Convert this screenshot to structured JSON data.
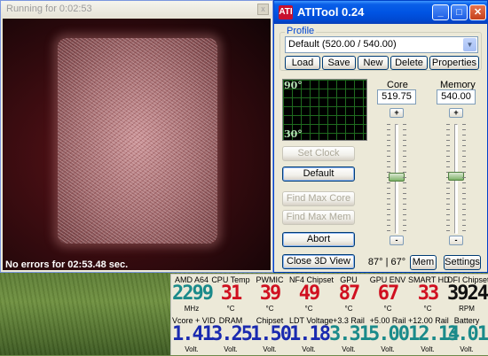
{
  "render_window": {
    "title": "Running for 0:02:53",
    "close": "x",
    "status": "No errors for 02:53.48 sec."
  },
  "ati": {
    "title": "ATITool 0.24",
    "logo": "ATI",
    "buttons": {
      "minimize": "_",
      "maximize": "□",
      "close": "✕"
    },
    "profile_label": "Profile",
    "profile_value": "Default (520.00 / 540.00)",
    "profile_buttons": {
      "load": "Load",
      "save": "Save",
      "new": "New",
      "delete": "Delete",
      "properties": "Properties"
    },
    "graph": {
      "top_label": "90°",
      "bottom_label": "30°"
    },
    "core": {
      "label": "Core",
      "value": "519.75",
      "plus": "+",
      "minus": "-"
    },
    "memory": {
      "label": "Memory",
      "value": "540.00",
      "plus": "+",
      "minus": "-"
    },
    "actions": {
      "set_clock": "Set Clock",
      "default": "Default",
      "find_max_core": "Find Max Core",
      "find_max_mem": "Find Max Mem",
      "abort": "Abort",
      "close_3d": "Close 3D View",
      "temp": "87° | 67°",
      "mem": "Mem",
      "settings": "Settings"
    }
  },
  "sensors": {
    "row1": [
      {
        "label": "AMD A64",
        "value": "2299",
        "unit": "MHz",
        "color": "#1a8a8a"
      },
      {
        "label": "CPU Temp",
        "value": "31",
        "unit": "°C",
        "color": "#d01020"
      },
      {
        "label": "PWMIC",
        "value": "39",
        "unit": "°C",
        "color": "#d01020"
      },
      {
        "label": "NF4 Chipset",
        "value": "49",
        "unit": "°C",
        "color": "#d01020"
      },
      {
        "label": "GPU",
        "value": "87",
        "unit": "°C",
        "color": "#d01020"
      },
      {
        "label": "GPU ENV",
        "value": "67",
        "unit": "°C",
        "color": "#d01020"
      },
      {
        "label": "SMART HD",
        "value": "33",
        "unit": "°C",
        "color": "#d01020"
      },
      {
        "label": "DFI Chipset",
        "value": "3924",
        "unit": "RPM",
        "color": "#111111"
      }
    ],
    "row2": [
      {
        "label": "Vcore + VID",
        "value": "1.41",
        "unit": "Volt.",
        "color": "#1a2ab0"
      },
      {
        "label": "DRAM",
        "value": "3.25",
        "unit": "Volt.",
        "color": "#1a2ab0"
      },
      {
        "label": "Chipset",
        "value": "1.50",
        "unit": "Volt.",
        "color": "#1a2ab0"
      },
      {
        "label": "LDT Voltage",
        "value": "1.18",
        "unit": "Volt.",
        "color": "#1a2ab0"
      },
      {
        "label": "+3.3 Rail",
        "value": "3.31",
        "unit": "Volt.",
        "color": "#1a8a8a"
      },
      {
        "label": "+5.00 Rail",
        "value": "5.00",
        "unit": "Volt.",
        "color": "#1a8a8a"
      },
      {
        "label": "+12.00 Rail",
        "value": "12.14",
        "unit": "Volt.",
        "color": "#1a8a8a"
      },
      {
        "label": "Battery",
        "value": "3.01",
        "unit": "Volt.",
        "color": "#1a8a8a"
      }
    ]
  }
}
